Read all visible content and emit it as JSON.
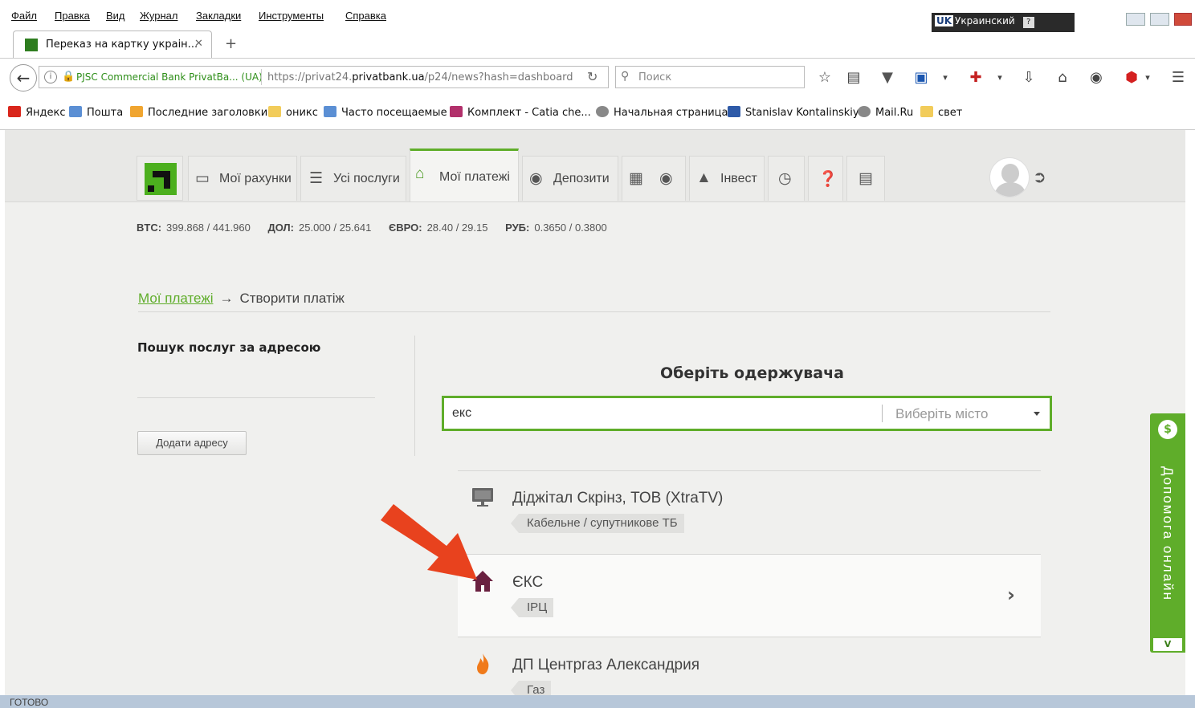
{
  "menu": [
    "Файл",
    "Правка",
    "Вид",
    "Журнал",
    "Закладки",
    "Инструменты",
    "Справка"
  ],
  "language": {
    "code": "UK",
    "name": "Украинский"
  },
  "tab": {
    "title": "Переказ на картку украін...",
    "close": "✕",
    "new": "+"
  },
  "urlbar": {
    "owner": "PJSC Commercial Bank PrivatBa... (UA)",
    "url_prefix": "https://privat24.",
    "url_domain": "privatbank.ua",
    "url_path": "/p24/news?hash=dashboard"
  },
  "search": {
    "placeholder": "Поиск"
  },
  "bookmarks": [
    {
      "label": "Яндекс",
      "color": "#d9261c"
    },
    {
      "label": "Пошта",
      "color": "#5b8fd4"
    },
    {
      "label": "Последние заголовки",
      "color": "#f0a530"
    },
    {
      "label": "оникс",
      "color": "#f2cc5a"
    },
    {
      "label": "Часто посещаемые",
      "color": "#5b8fd4"
    },
    {
      "label": "Комплект - Catia che...",
      "color": "#b2306b"
    },
    {
      "label": "Начальная страница",
      "color": "#888888"
    },
    {
      "label": "Stanislav Kontalinskiy",
      "color": "#2e5aa8"
    },
    {
      "label": "Mail.Ru",
      "color": "#888888"
    },
    {
      "label": "свет",
      "color": "#f2cc5a"
    }
  ],
  "nav": {
    "accounts": "Мої рахунки",
    "services": "Усі послуги",
    "payments": "Мої платежі",
    "deposits": "Депозити",
    "invest": "Інвест"
  },
  "rates": [
    {
      "label": "BTC:",
      "value": "399.868 / 441.960"
    },
    {
      "label": "ДОЛ:",
      "value": "25.000 / 25.641"
    },
    {
      "label": "ЄВРО:",
      "value": "28.40 / 29.15"
    },
    {
      "label": "РУБ:",
      "value": "0.3650 / 0.3800"
    }
  ],
  "breadcrumb": {
    "link": "Мої платежі",
    "arrow": "→",
    "current": "Створити платіж"
  },
  "left_panel": {
    "title": "Пошук послуг за адресою",
    "add_button": "Додати адресу"
  },
  "recipient": {
    "title": "Оберіть одержувача",
    "query": "екс",
    "city_placeholder": "Виберіть місто"
  },
  "results": [
    {
      "name": "Діджітал Скрінз, ТОВ (XtraTV)",
      "tag": "Кабельне / супутникове ТБ",
      "icon": "tv-icon"
    },
    {
      "name": "ЄКС",
      "tag": "ІРЦ",
      "icon": "house-icon"
    },
    {
      "name": "ДП Центргаз Александрия",
      "tag": "Газ",
      "icon": "flame-icon"
    }
  ],
  "help": {
    "label": "Допомога онлайн",
    "toggle": "V"
  },
  "status": "ГОТОВО",
  "colors": {
    "accent": "#5fad2a",
    "arrow": "#e8421e",
    "house": "#6a2040",
    "flame": "#f07a1a"
  }
}
